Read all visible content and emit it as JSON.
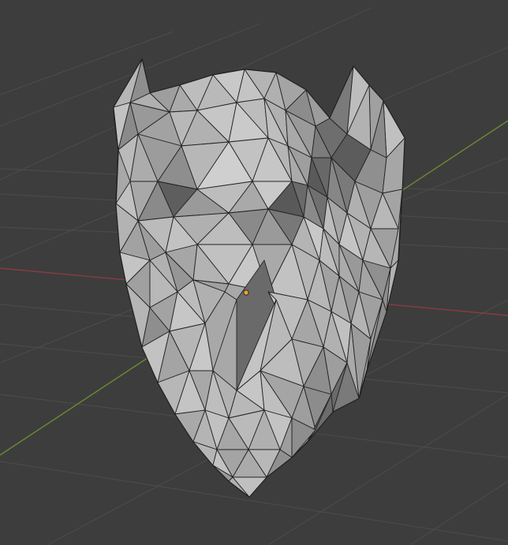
{
  "viewport": {
    "mode": "3d-viewport",
    "shading": "solid",
    "overlay_wireframe": true,
    "object": "low-poly-mask-mesh"
  },
  "colors": {
    "background": "#3d3d3d",
    "grid_line": "#4a4a4a",
    "x_axis": "#8a3b43",
    "y_axis": "#6a8a32",
    "mesh_light": "#b9b9b9",
    "mesh_mid": "#9a9a9a",
    "mesh_dark": "#6e6e6e",
    "mesh_deep": "#4e4e4e",
    "wire": "#1e1e1e",
    "origin": "#f0a030"
  }
}
